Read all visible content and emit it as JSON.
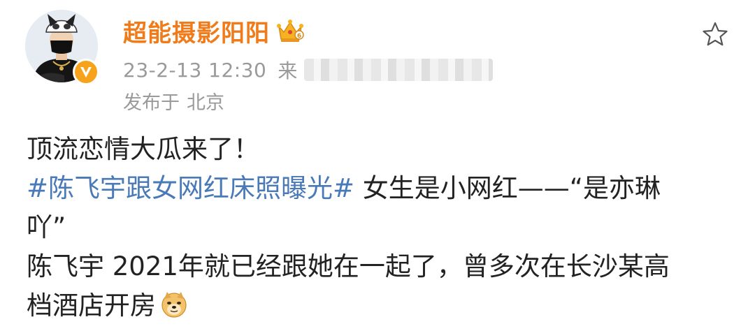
{
  "post": {
    "author": {
      "name": "超能摄影阳阳"
    },
    "meta": {
      "time": "23-2-13 12:30",
      "source_prefix": "来",
      "location_label": "发布于",
      "location": "北京"
    },
    "content": {
      "line1": "顶流恋情大瓜来了！",
      "hashtag": "#陈飞宇跟女网红床照曝光#",
      "line2_rest": " 女生是小网红——“是亦琳",
      "line3": "吖”",
      "line4": "陈飞宇 2021年就已经跟她在一起了，曾多次在长沙某高",
      "line5": "档酒店开房"
    },
    "icons": {
      "avatar": "avatar-image",
      "verified": "verified-v-icon",
      "crown": "crown-badge-icon",
      "star": "star-outline-icon",
      "emoji": "doge-emoji-icon"
    },
    "colors": {
      "username": "#f07b1a",
      "hashtag": "#4a79b7",
      "meta": "#9a9a9a",
      "text": "#222222",
      "verified": "#f7a21b"
    }
  }
}
